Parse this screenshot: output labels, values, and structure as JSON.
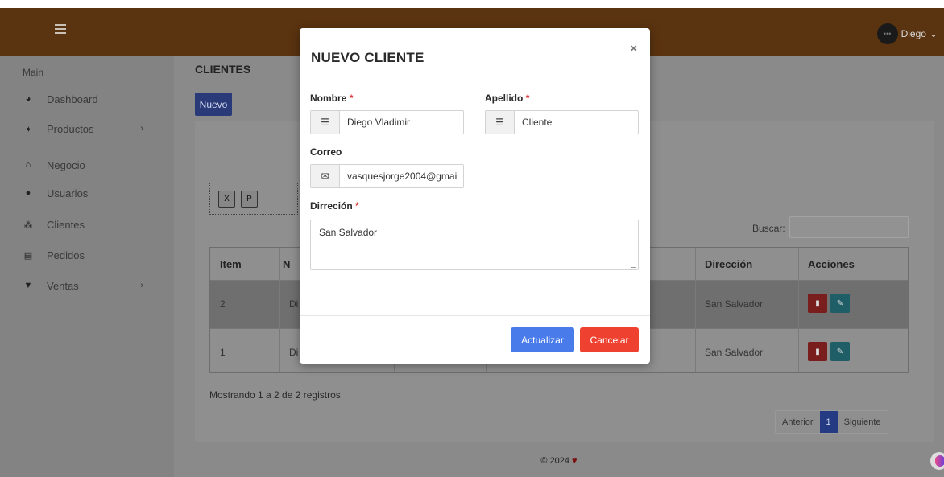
{
  "header": {
    "user_name": "Diego",
    "user_chevron": "⌄"
  },
  "sidebar": {
    "section": "Main",
    "items": [
      {
        "label": "Dashboard",
        "icon": "pie-chart-icon"
      },
      {
        "label": "Productos",
        "icon": "tag-icon"
      },
      {
        "label": "Negocio",
        "icon": "home-icon"
      },
      {
        "label": "Usuarios",
        "icon": "user-icon"
      },
      {
        "label": "Clientes",
        "icon": "users-icon"
      },
      {
        "label": "Pedidos",
        "icon": "list-icon"
      },
      {
        "label": "Ventas",
        "icon": "cart-icon"
      }
    ]
  },
  "page": {
    "title": "CLIENTES",
    "new_button": "Nuevo",
    "search_label": "Buscar:",
    "table": {
      "headers": {
        "item": "Item",
        "nombre": "N",
        "direccion": "Dirección",
        "acciones": "Acciones"
      },
      "rows": [
        {
          "item": "2",
          "nombre": "Di",
          "direccion": "San Salvador"
        },
        {
          "item": "1",
          "nombre": "Di",
          "direccion": "San Salvador"
        }
      ]
    },
    "info": "Mostrando 1 a 2 de 2 registros",
    "pagination": {
      "prev": "Anterior",
      "current": "1",
      "next": "Siguiente"
    }
  },
  "footer": {
    "text": "© 2024",
    "heart": "♥"
  },
  "modal": {
    "title": "NUEVO CLIENTE",
    "close": "×",
    "fields": {
      "nombre": {
        "label": "Nombre",
        "value": "Diego Vladimir"
      },
      "apellido": {
        "label": "Apellido",
        "value": "Cliente"
      },
      "correo": {
        "label": "Correo",
        "value": "vasquesjorge2004@gmai"
      },
      "direccion": {
        "label": "Dirreción",
        "value": "San Salvador"
      }
    },
    "required_mark": "*",
    "update_button": "Actualizar",
    "cancel_button": "Cancelar"
  },
  "colors": {
    "topbar": "#5a3310",
    "primary": "#4a7bea",
    "danger": "#ee4130",
    "required": "#e23b3b"
  }
}
